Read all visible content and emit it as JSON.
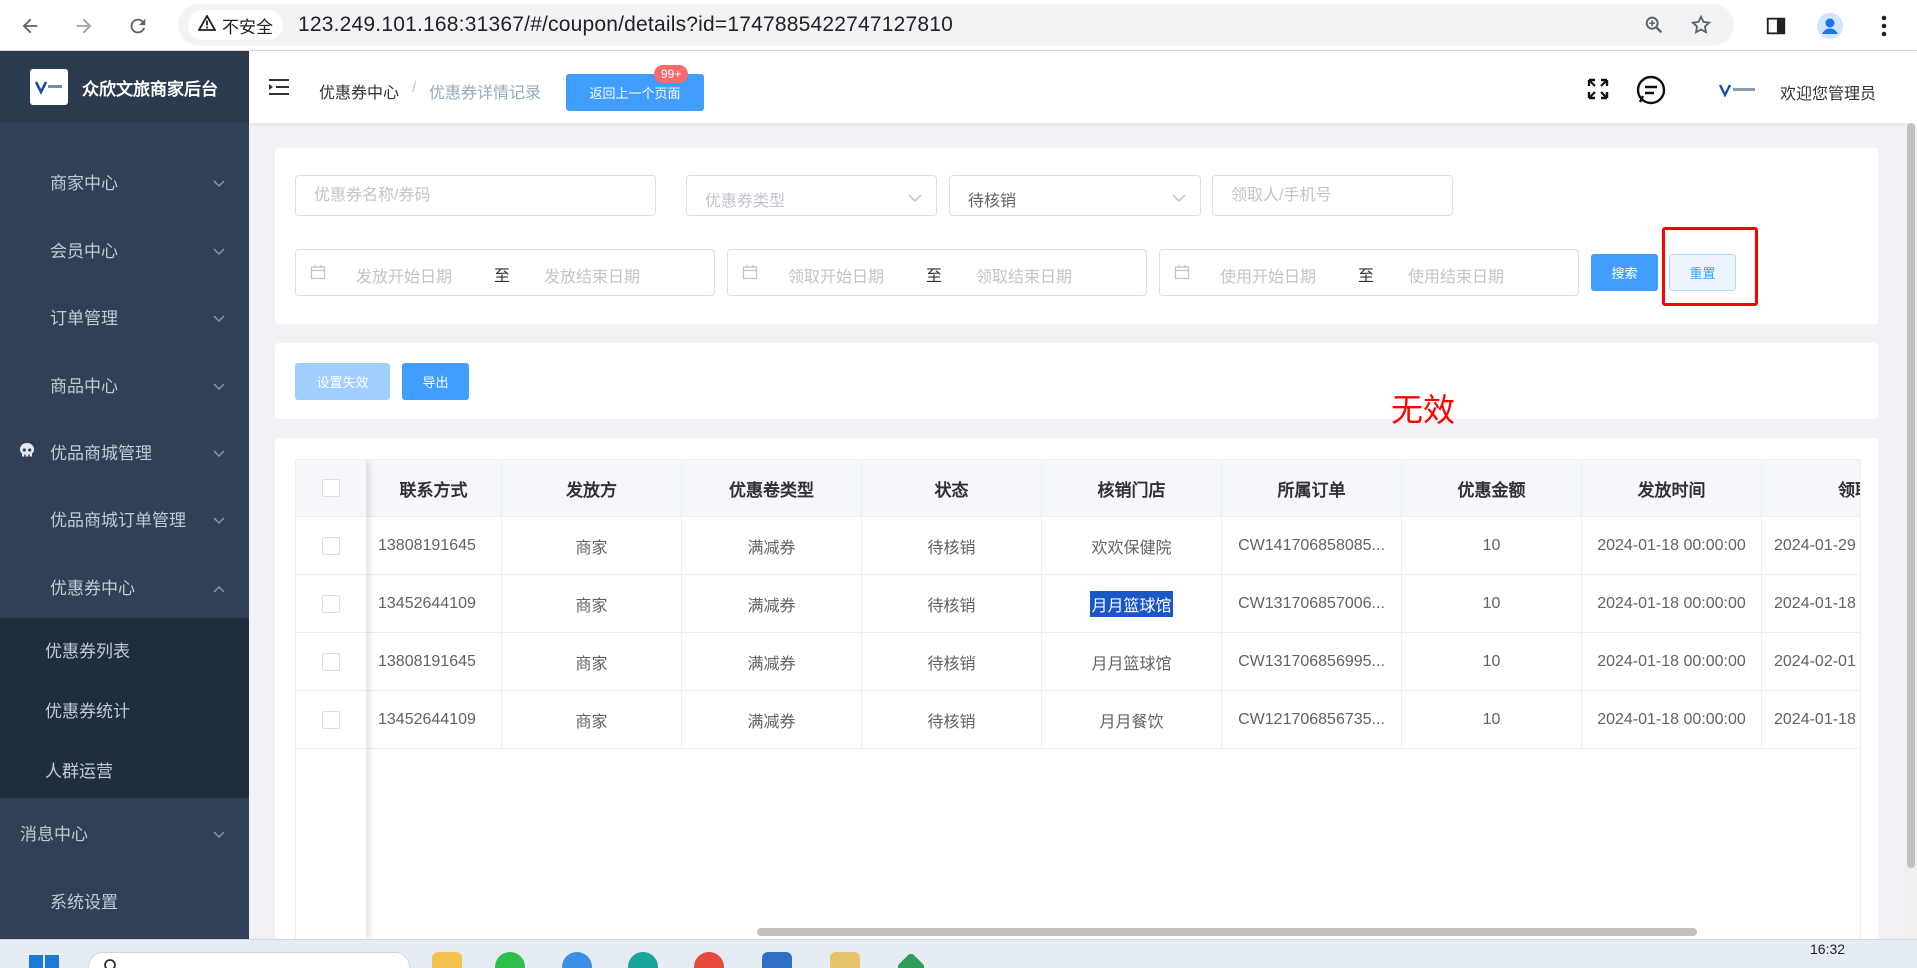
{
  "browser": {
    "security_label": "不安全",
    "url": "123.249.101.168:31367/#/coupon/details?id=1747885422747127810"
  },
  "sidebar": {
    "brand_title": "众欣文旅商家后台",
    "menu": [
      {
        "label": "商家中心"
      },
      {
        "label": "会员中心"
      },
      {
        "label": "订单管理"
      },
      {
        "label": "商品中心"
      },
      {
        "label": "优品商城管理"
      },
      {
        "label": "优品商城订单管理"
      },
      {
        "label": "优惠券中心"
      }
    ],
    "submenu": [
      {
        "label": "优惠券列表"
      },
      {
        "label": "优惠券统计"
      },
      {
        "label": "人群运营"
      }
    ],
    "bottom_menu": [
      {
        "label": "消息中心"
      },
      {
        "label": "系统设置"
      }
    ]
  },
  "header": {
    "breadcrumb_home": "优惠券中心",
    "breadcrumb_sep": "/",
    "breadcrumb_current": "优惠券详情记录",
    "back_button": "返回上一个页面",
    "badge": "99+",
    "welcome": "欢迎您管理员"
  },
  "filters": {
    "name_placeholder": "优惠券名称/券码",
    "type_placeholder": "优惠券类型",
    "status_value": "待核销",
    "receiver_placeholder": "领取人/手机号",
    "issue_start": "发放开始日期",
    "issue_end": "发放结束日期",
    "receive_start": "领取开始日期",
    "receive_end": "领取结束日期",
    "use_start": "使用开始日期",
    "use_end": "使用结束日期",
    "range_sep": "至",
    "search_button": "搜索",
    "reset_button": "重置"
  },
  "actions": {
    "invalidate_button": "设置失效",
    "export_button": "导出"
  },
  "annotation": "无效",
  "table": {
    "columns": [
      "联系方式",
      "发放方",
      "优惠卷类型",
      "状态",
      "核销门店",
      "所属订单",
      "优惠金额",
      "发放时间",
      "领取时"
    ],
    "rows": [
      {
        "phone": "13808191645",
        "issuer": "商家",
        "type": "满减券",
        "status": "待核销",
        "store": "欢欢保健院",
        "order": "CW141706858085...",
        "amount": "10",
        "issue_time": "2024-01-18 00:00:00",
        "receive_time": "2024-01-29"
      },
      {
        "phone": "13452644109",
        "issuer": "商家",
        "type": "满减券",
        "status": "待核销",
        "store": "月月篮球馆",
        "order": "CW131706857006...",
        "amount": "10",
        "issue_time": "2024-01-18 00:00:00",
        "receive_time": "2024-01-18"
      },
      {
        "phone": "13808191645",
        "issuer": "商家",
        "type": "满减券",
        "status": "待核销",
        "store": "月月篮球馆",
        "order": "CW131706856995...",
        "amount": "10",
        "issue_time": "2024-01-18 00:00:00",
        "receive_time": "2024-02-01"
      },
      {
        "phone": "13452644109",
        "issuer": "商家",
        "type": "满减券",
        "status": "待核销",
        "store": "月月餐饮",
        "order": "CW121706856735...",
        "amount": "10",
        "issue_time": "2024-01-18 00:00:00",
        "receive_time": "2024-01-18"
      }
    ]
  },
  "taskbar": {
    "clock": "16:32"
  },
  "colors": {
    "sidebar_bg": "#304156",
    "primary": "#409eff",
    "annotation_red": "#ff0000",
    "selection_highlight": "#1a56c8"
  },
  "icons": [
    "back-arrow-icon",
    "forward-arrow-icon",
    "reload-icon",
    "warning-icon",
    "zoom-icon",
    "star-icon",
    "side-panel-icon",
    "profile-icon",
    "more-vert-icon",
    "hamburger-icon",
    "fullscreen-icon",
    "chat-icon",
    "calendar-icon",
    "chevron-down-icon"
  ]
}
